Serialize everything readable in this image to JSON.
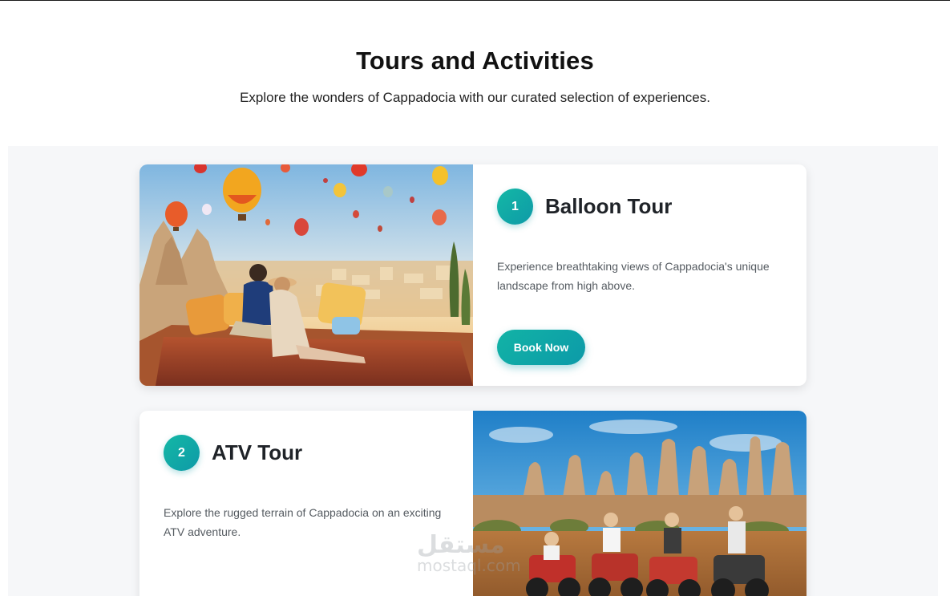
{
  "section": {
    "title": "Tours and Activities",
    "subtitle": "Explore the wonders of Cappadocia with our curated selection of experiences."
  },
  "tours": [
    {
      "number": "1",
      "title": "Balloon Tour",
      "description": "Experience breathtaking views of Cappadocia's unique landscape from high above.",
      "button_label": "Book Now",
      "image": "couple-watching-hot-air-balloons-photo"
    },
    {
      "number": "2",
      "title": "ATV Tour",
      "description": "Explore the rugged terrain of Cappadocia on an exciting ATV adventure.",
      "image": "atv-riders-fairy-chimneys-photo"
    }
  ],
  "watermark": {
    "arabic": "مستقل",
    "latin": "mostaql.com"
  },
  "colors": {
    "accent": "#12b3a6",
    "panel_bg": "#f6f7f9",
    "card_bg": "#ffffff"
  }
}
